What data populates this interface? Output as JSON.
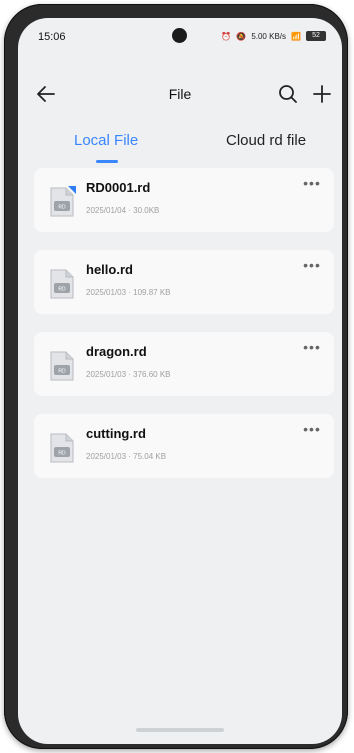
{
  "status": {
    "time": "15:06",
    "net_a": "5.00",
    "net_b": "KB/s",
    "battery": "52"
  },
  "appbar": {
    "title": "File"
  },
  "tabs": [
    {
      "label": "Local File",
      "active": true
    },
    {
      "label": "Cloud rd file",
      "active": false
    }
  ],
  "files": [
    {
      "name": "RD0001.rd",
      "meta": "2025/01/04 · 30.0KB",
      "badge": true
    },
    {
      "name": "hello.rd",
      "meta": "2025/01/03 · 109.87 KB",
      "badge": false
    },
    {
      "name": "dragon.rd",
      "meta": "2025/01/03 · 376.60 KB",
      "badge": false
    },
    {
      "name": "cutting.rd",
      "meta": "2025/01/03 · 75.04 KB",
      "badge": false
    }
  ],
  "icons": {
    "back": "arrow-left-icon",
    "search": "search-icon",
    "add": "plus-icon",
    "more": "more-horizontal-icon",
    "file": "rd-file-icon"
  },
  "colors": {
    "accent": "#3a86ff",
    "background": "#eef0f2",
    "card": "#f9f9fa"
  }
}
